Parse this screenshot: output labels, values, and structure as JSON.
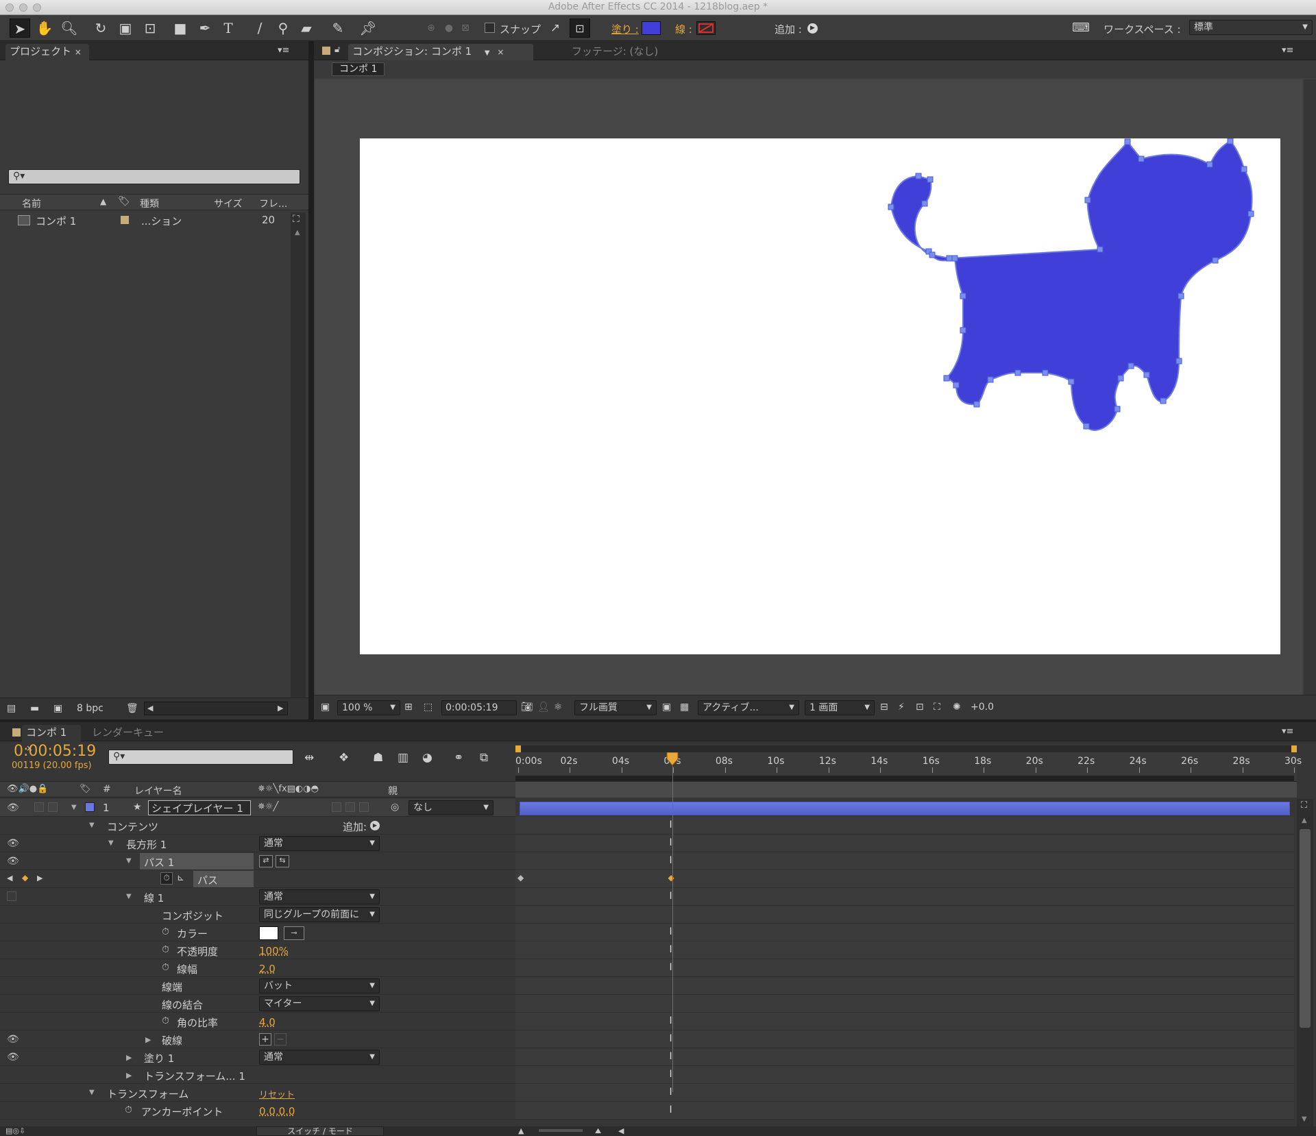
{
  "window": {
    "title": "Adobe After Effects CC 2014 - 1218blog.aep *"
  },
  "toolbar": {
    "snap_label": "スナップ",
    "fill_label": "塗り :",
    "stroke_label": "線 :",
    "add_label": "追加 :",
    "workspace_label": "ワークスペース :",
    "workspace_value": "標準",
    "fill_color": "#4040d8",
    "stroke_color": "#d83030"
  },
  "project": {
    "tab": "プロジェクト",
    "search_placeholder": "",
    "columns": {
      "name": "名前",
      "type": "種類",
      "size": "サイズ",
      "frame": "フレ..."
    },
    "items": [
      {
        "name": "コンポ 1",
        "type": "...ション",
        "frame": "20"
      }
    ],
    "footer": {
      "bpc": "8 bpc"
    }
  },
  "comp_panel": {
    "tab_label": "コンポジション: コンポ 1",
    "footage_tab": "フッテージ: (なし)",
    "breadcrumb": "コンポ 1",
    "shape_color": "#4040d8",
    "footer": {
      "zoom": "100 %",
      "timecode": "0:00:05:19",
      "quality": "フル画質",
      "camera": "アクティブ...",
      "views": "1 画面",
      "exposure": "+0.0"
    }
  },
  "timeline": {
    "tab": "コンポ 1",
    "render_queue_tab": "レンダーキュー",
    "timecode": "0:00:05:19",
    "frame_info": "00119 (20.00 fps)",
    "columns": {
      "hash": "#",
      "layer_name": "レイヤー名",
      "parent": "親"
    },
    "ruler": [
      "0:00s",
      "02s",
      "04s",
      "06s",
      "08s",
      "10s",
      "12s",
      "14s",
      "16s",
      "18s",
      "20s",
      "22s",
      "24s",
      "26s",
      "28s",
      "30s"
    ],
    "current_time_seconds": 5.95,
    "duration_seconds": 30,
    "layer": {
      "index": "1",
      "name": "シェイプレイヤー 1",
      "parent": "なし",
      "color": "#6a78e0"
    },
    "props": {
      "contents": "コンテンツ",
      "add": "追加:",
      "rect1": "長方形 1",
      "rect1_mode": "通常",
      "path1": "パス 1",
      "path": "パス",
      "stroke1": "線 1",
      "stroke1_mode": "通常",
      "composite": "コンポジット",
      "composite_value": "同じグループの前面に",
      "color": "カラー",
      "opacity": "不透明度",
      "opacity_value": "100%",
      "stroke_width": "線幅",
      "stroke_width_value": "2.0",
      "line_cap": "線端",
      "line_cap_value": "バット",
      "line_join": "線の結合",
      "line_join_value": "マイター",
      "miter_limit": "角の比率",
      "miter_limit_value": "4.0",
      "dashes": "破線",
      "fill1": "塗り 1",
      "fill1_mode": "通常",
      "transform1": "トランスフォーム... 1",
      "transform": "トランスフォーム",
      "reset": "リセット",
      "anchor": "アンカーポイント",
      "anchor_value": "0.0,0.0"
    },
    "footer": {
      "switch_mode": "スイッチ / モード"
    }
  }
}
